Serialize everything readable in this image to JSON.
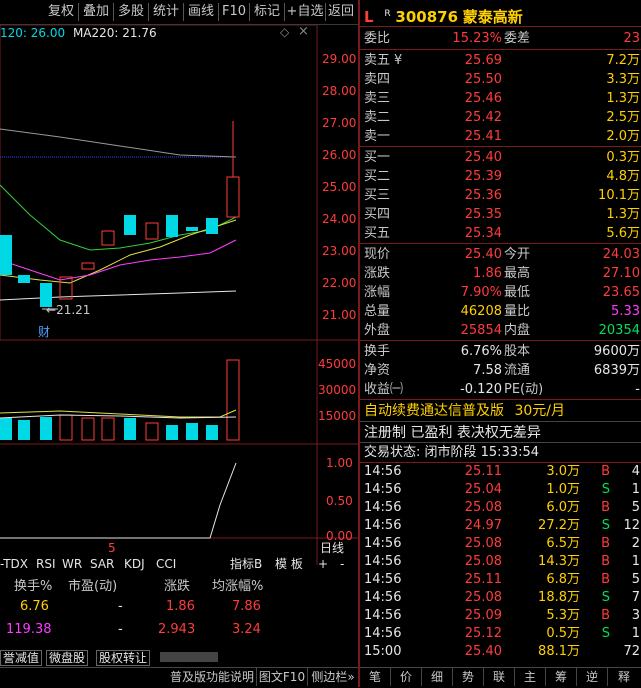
{
  "toolbar": {
    "buttons": [
      "复权",
      "叠加",
      "多股",
      "统计",
      "画线",
      "F10",
      "标记",
      "+自选",
      "返回"
    ]
  },
  "chart_header": {
    "ma_prev": "120: 26.00",
    "ma220": "MA220: 21.76",
    "diamond": "◇",
    "close": "×"
  },
  "price_axis": [
    "29.00",
    "28.00",
    "27.00",
    "26.00",
    "25.00",
    "24.00",
    "23.00",
    "22.00",
    "21.00"
  ],
  "low_label": "21.21",
  "cai_label": "财",
  "vol_axis": [
    "45000",
    "30000",
    "15000"
  ],
  "ind_axis": [
    "1.00",
    "0.50",
    "0.00"
  ],
  "date_label": "5",
  "line_btn": "日线",
  "indicator_tabs": [
    "-TDX",
    "RSI",
    "WR",
    "SAR",
    "KDJ",
    "CCI"
  ],
  "ind_right": [
    "指标B",
    "模 板",
    "+",
    "-"
  ],
  "mini_table": {
    "headers": [
      "换手%",
      "市盈(动)",
      "涨跌",
      "均涨幅%"
    ],
    "rows": [
      [
        "6.76",
        "-",
        "1.86",
        "7.86"
      ],
      [
        "119.38",
        "-",
        "2.943",
        "3.24"
      ]
    ]
  },
  "bottom_tabs": [
    "誉减值",
    "微盘股",
    "股权转让"
  ],
  "bottom_bar": [
    "普及版功能说明",
    "图文F10",
    "侧边栏»",
    "笔",
    "价",
    "细",
    "势",
    "联",
    "主",
    "筹",
    "逆",
    "释"
  ],
  "stock": {
    "flag": "L",
    "r": "R",
    "code": "300876",
    "name": "蒙泰高新"
  },
  "weibi": {
    "label": "委比",
    "value": "15.23%",
    "diff_label": "委差",
    "diff": "23"
  },
  "asks": [
    {
      "label": "卖五",
      "mark": "¥",
      "price": "25.69",
      "vol": "7.2万"
    },
    {
      "label": "卖四",
      "price": "25.50",
      "vol": "3.3万"
    },
    {
      "label": "卖三",
      "price": "25.46",
      "vol": "1.3万"
    },
    {
      "label": "卖二",
      "price": "25.42",
      "vol": "2.5万"
    },
    {
      "label": "卖一",
      "price": "25.41",
      "vol": "2.0万"
    }
  ],
  "bids": [
    {
      "label": "买一",
      "price": "25.40",
      "vol": "0.3万"
    },
    {
      "label": "买二",
      "price": "25.39",
      "vol": "4.8万"
    },
    {
      "label": "买三",
      "price": "25.36",
      "vol": "10.1万"
    },
    {
      "label": "买四",
      "price": "25.35",
      "vol": "1.3万"
    },
    {
      "label": "买五",
      "price": "25.34",
      "vol": "5.6万"
    }
  ],
  "quote": [
    {
      "l1": "现价",
      "v1": "25.40",
      "c1": "red",
      "l2": "今开",
      "v2": "24.03",
      "c2": "red"
    },
    {
      "l1": "涨跌",
      "v1": "1.86",
      "c1": "red",
      "l2": "最高",
      "v2": "27.10",
      "c2": "red"
    },
    {
      "l1": "涨幅",
      "v1": "7.90%",
      "c1": "red",
      "l2": "最低",
      "v2": "23.65",
      "c2": "red"
    },
    {
      "l1": "总量",
      "v1": "46208",
      "c1": "ylw",
      "l2": "量比",
      "v2": "5.33",
      "c2": "mag"
    },
    {
      "l1": "外盘",
      "v1": "25854",
      "c1": "red",
      "l2": "内盘",
      "v2": "20354",
      "c2": "grn"
    }
  ],
  "fund": [
    {
      "l1": "换手",
      "v1": "6.76%",
      "l2": "股本",
      "v2": "9600万"
    },
    {
      "l1": "净资",
      "v1": "7.58",
      "l2": "流通",
      "v2": "6839万"
    },
    {
      "l1": "收益㈠",
      "v1": "-0.120",
      "l2": "PE(动)",
      "v2": "-"
    }
  ],
  "ad1": {
    "text": "自动续费通达信普及版",
    "price": "30元/月"
  },
  "ad2": "注册制 已盈利 表决权无差异",
  "trade_status": "交易状态: 闭市阶段 15:33:54",
  "ticks": [
    {
      "t": "14:56",
      "p": "25.11",
      "v": "3.0万",
      "bs": "B",
      "n": "4"
    },
    {
      "t": "14:56",
      "p": "25.04",
      "v": "1.0万",
      "bs": "S",
      "n": "1"
    },
    {
      "t": "14:56",
      "p": "25.08",
      "v": "6.0万",
      "bs": "B",
      "n": "5"
    },
    {
      "t": "14:56",
      "p": "24.97",
      "v": "27.2万",
      "bs": "S",
      "n": "12"
    },
    {
      "t": "14:56",
      "p": "25.08",
      "v": "6.5万",
      "bs": "B",
      "n": "2"
    },
    {
      "t": "14:56",
      "p": "25.08",
      "v": "14.3万",
      "bs": "B",
      "n": "1"
    },
    {
      "t": "14:56",
      "p": "25.11",
      "v": "6.8万",
      "bs": "B",
      "n": "5"
    },
    {
      "t": "14:56",
      "p": "25.08",
      "v": "18.8万",
      "bs": "S",
      "n": "7"
    },
    {
      "t": "14:56",
      "p": "25.09",
      "v": "5.3万",
      "bs": "B",
      "n": "3"
    },
    {
      "t": "14:56",
      "p": "25.12",
      "v": "0.5万",
      "bs": "S",
      "n": "1"
    },
    {
      "t": "15:00",
      "p": "25.40",
      "v": "88.1万",
      "bs": "",
      "n": "72"
    }
  ],
  "colors": {
    "up": "#ff3c3c",
    "down": "#00d8e6",
    "ask_bid_bg": "#000000",
    "frame": "#7a1a1a"
  }
}
